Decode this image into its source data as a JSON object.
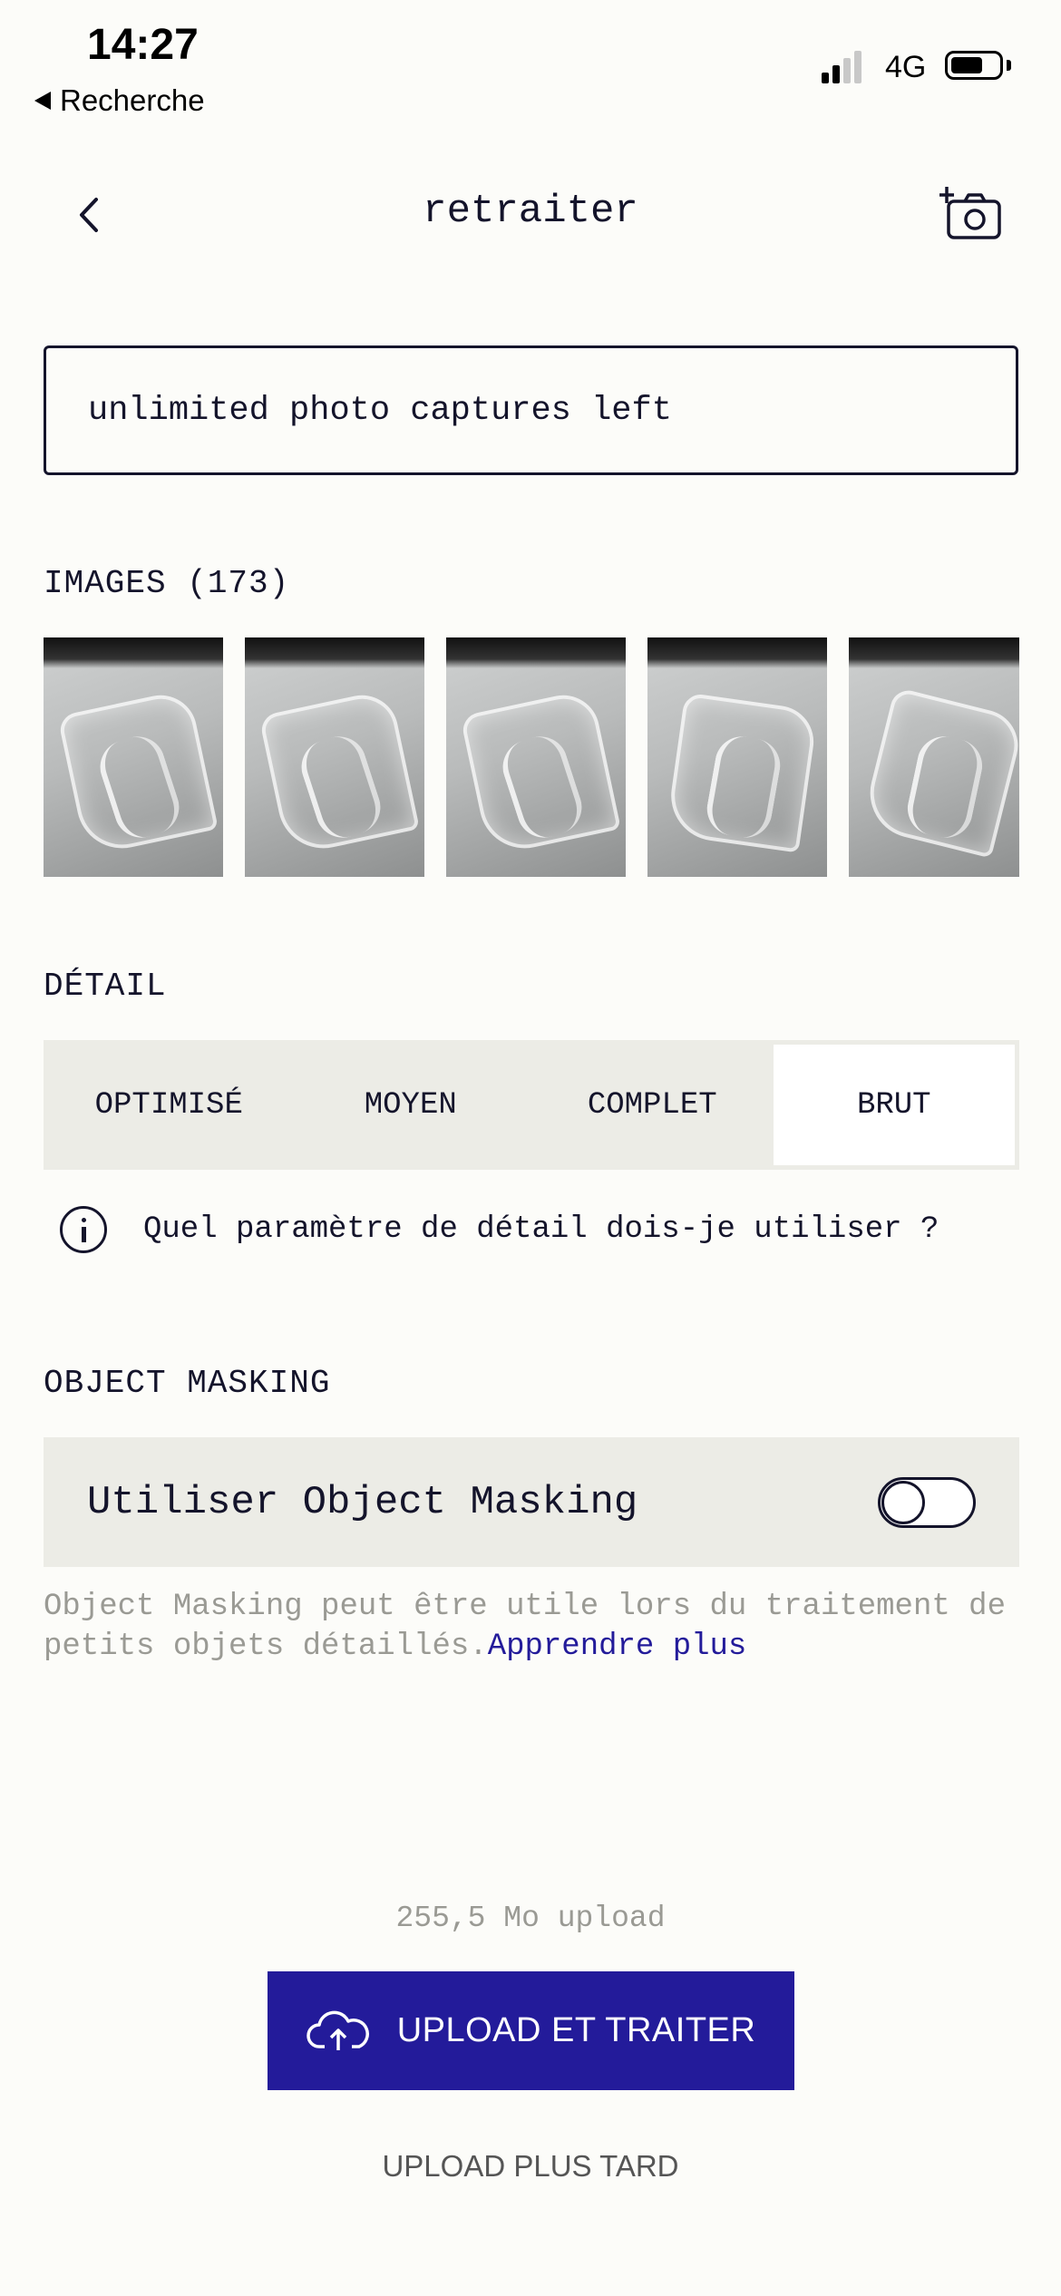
{
  "status_bar": {
    "time": "14:27",
    "back_app": "Recherche",
    "network": "4G"
  },
  "nav": {
    "title": "retraiter"
  },
  "captures_text": "unlimited photo captures left",
  "images": {
    "label": "IMAGES (173)"
  },
  "detail": {
    "label": "DÉTAIL",
    "options": [
      "OPTIMISÉ",
      "MOYEN",
      "COMPLET",
      "BRUT"
    ],
    "selected": "BRUT",
    "help_text": "Quel paramètre de détail dois-je utiliser ?"
  },
  "object_masking": {
    "label": "OBJECT MASKING",
    "toggle_label": "Utiliser Object Masking",
    "toggle_on": false,
    "note": "Object Masking peut être utile lors du traitement de petits objets détaillés.",
    "learn_more": "Apprendre plus"
  },
  "upload": {
    "size_text": "255,5 Mo upload",
    "button_label": "UPLOAD ET TRAITER",
    "later_label": "UPLOAD PLUS TARD"
  },
  "colors": {
    "accent": "#231b9a",
    "text": "#14142b",
    "panel": "#ecece6"
  }
}
